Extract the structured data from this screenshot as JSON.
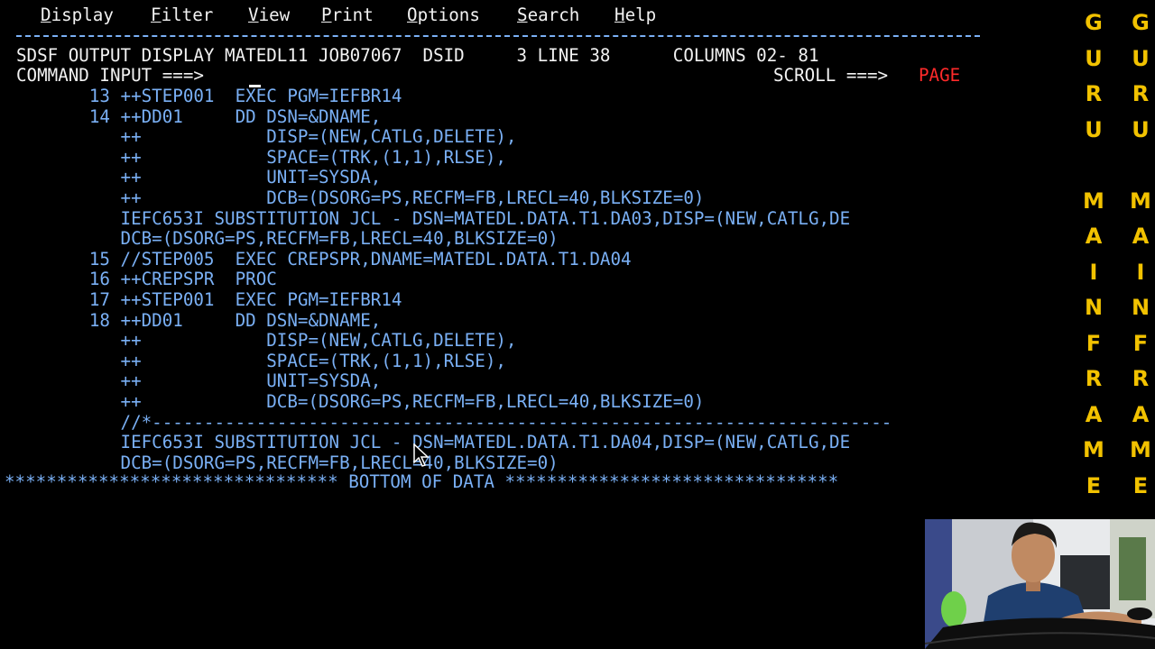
{
  "menu": {
    "items": [
      {
        "hot": "D",
        "rest": "isplay"
      },
      {
        "hot": "F",
        "rest": "ilter"
      },
      {
        "hot": "V",
        "rest": "iew"
      },
      {
        "hot": "P",
        "rest": "rint"
      },
      {
        "hot": "O",
        "rest": "ptions"
      },
      {
        "hot": "S",
        "rest": "earch"
      },
      {
        "hot": "H",
        "rest": "elp"
      }
    ]
  },
  "header": {
    "title_line": "SDSF OUTPUT DISPLAY MATEDL11 JOB07067  DSID     3 LINE 38      COLUMNS 02- 81",
    "command_label": "COMMAND INPUT ===>",
    "command_value": "",
    "scroll_label": "SCROLL ===>",
    "scroll_value": "PAGE"
  },
  "jcl_lines": [
    "       13 ++STEP001  EXEC PGM=IEFBR14",
    "       14 ++DD01     DD DSN=&DNAME,",
    "          ++            DISP=(NEW,CATLG,DELETE),",
    "          ++            SPACE=(TRK,(1,1),RLSE),",
    "          ++            UNIT=SYSDA,",
    "          ++            DCB=(DSORG=PS,RECFM=FB,LRECL=40,BLKSIZE=0)",
    "          IEFC653I SUBSTITUTION JCL - DSN=MATEDL.DATA.T1.DA03,DISP=(NEW,CATLG,DE",
    "          DCB=(DSORG=PS,RECFM=FB,LRECL=40,BLKSIZE=0)",
    "       15 //STEP005  EXEC CREPSPR,DNAME=MATEDL.DATA.T1.DA04",
    "       16 ++CREPSPR  PROC",
    "       17 ++STEP001  EXEC PGM=IEFBR14",
    "       18 ++DD01     DD DSN=&DNAME,",
    "          ++            DISP=(NEW,CATLG,DELETE),",
    "          ++            SPACE=(TRK,(1,1),RLSE),",
    "          ++            UNIT=SYSDA,",
    "          ++            DCB=(DSORG=PS,RECFM=FB,LRECL=40,BLKSIZE=0)",
    "          //*-----------------------------------------------------------------------",
    "          IEFC653I SUBSTITUTION JCL - DSN=MATEDL.DATA.T1.DA04,DISP=(NEW,CATLG,DE",
    "          DCB=(DSORG=PS,RECFM=FB,LRECL=40,BLKSIZE=0)"
  ],
  "bottom_line": "******************************** BOTTOM OF DATA ********************************",
  "sidebar": {
    "letters": [
      "G",
      "U",
      "R",
      "U",
      "",
      "M",
      "A",
      "I",
      "N",
      "F",
      "R",
      "A",
      "M",
      "E"
    ]
  },
  "colors": {
    "background": "#000000",
    "text_blue": "#7ab0f5",
    "text_white": "#f2f2f2",
    "scroll_red": "#ff2a2a",
    "sidebar_yellow": "#f2c200"
  }
}
